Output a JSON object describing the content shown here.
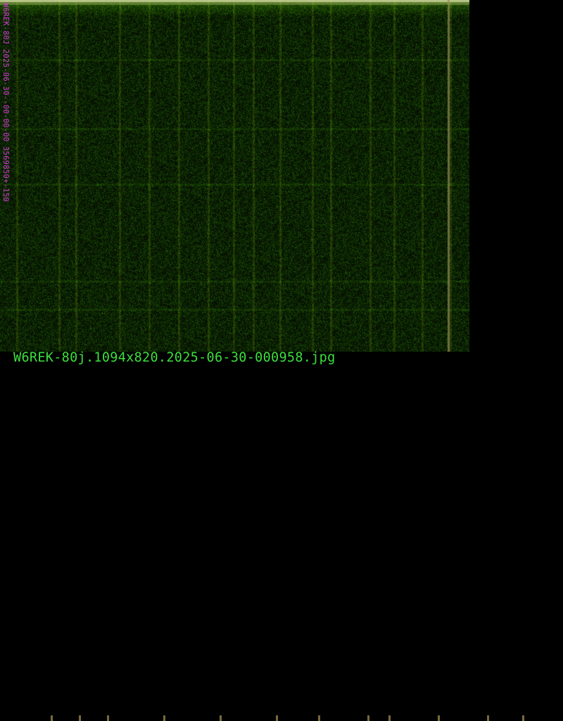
{
  "image_viewer": {
    "filename": "W6REK-80j.1094x820.2025-06-30-000958.jpg",
    "spectrogram_label": "W6REK-80J 2025-06-30--00-00-00 3569850+-150"
  },
  "colors": {
    "label_magenta": "#d43bd4",
    "filename_green": "#3ce03c",
    "background": "#000000",
    "noise_green": "#2a6a1a"
  }
}
